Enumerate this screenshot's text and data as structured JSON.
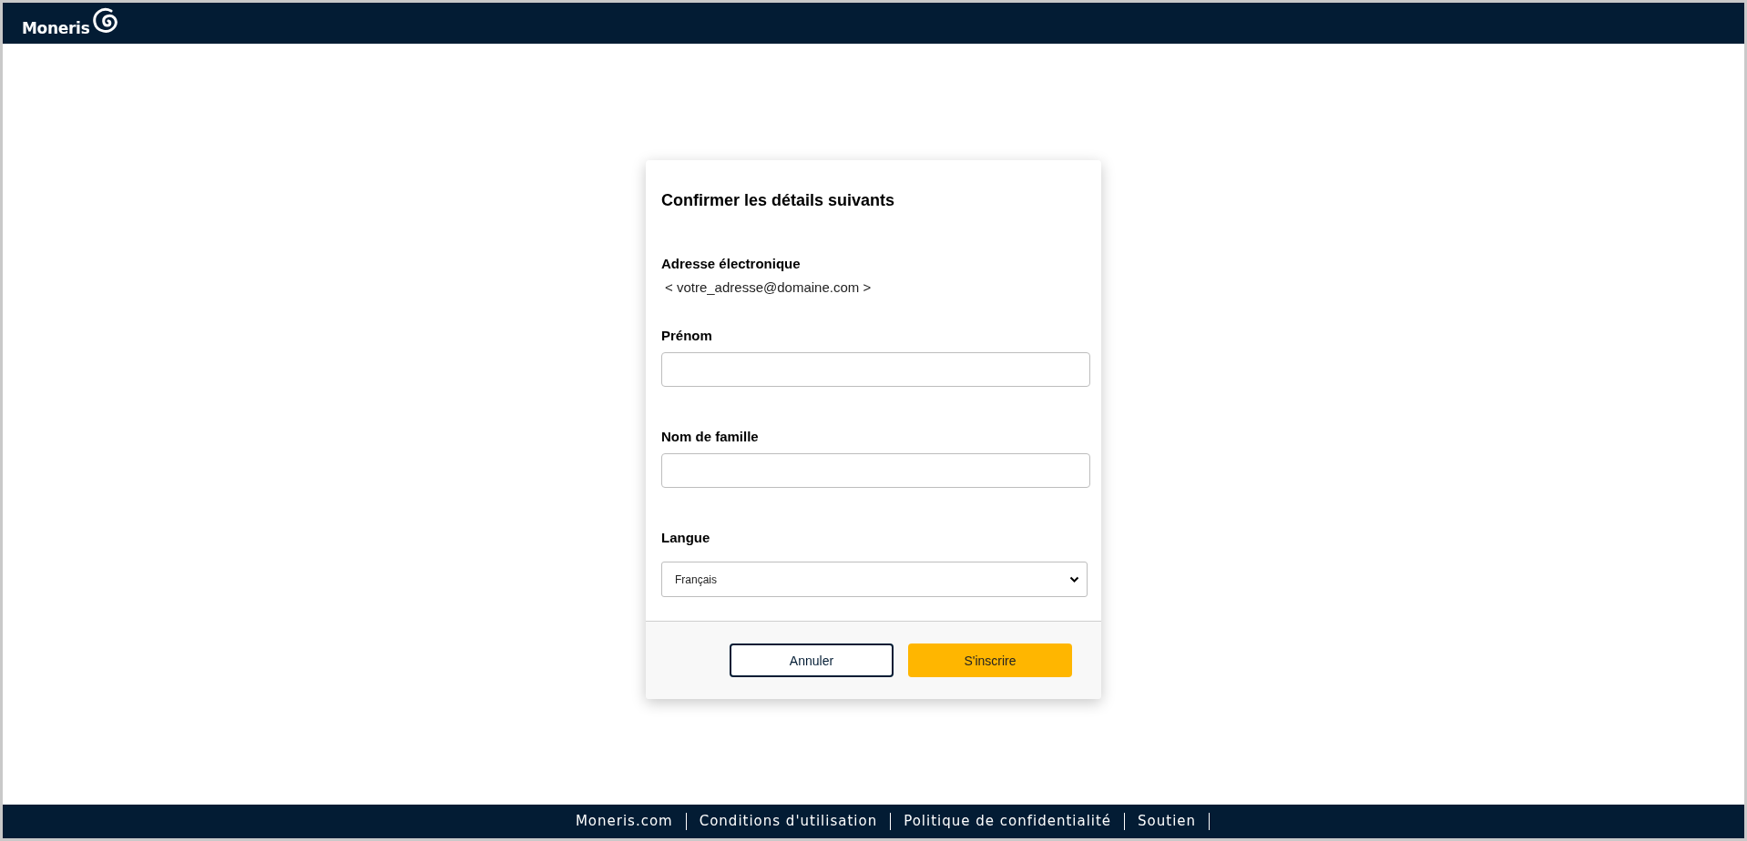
{
  "header": {
    "logo_text": "Moneris"
  },
  "dialog": {
    "title": "Confirmer les détails suivants",
    "fields": [
      {
        "kind": "static",
        "label": "Adresse électronique",
        "value": "< votre_adresse@domaine.com >"
      },
      {
        "kind": "text",
        "label": "Prénom"
      },
      {
        "kind": "text",
        "label": "Nom de famille"
      },
      {
        "kind": "select",
        "label": "Langue",
        "value": "Français"
      }
    ],
    "buttons": [
      {
        "kind": "secondary",
        "label": "Annuler"
      },
      {
        "kind": "primary",
        "label": "S'inscrire"
      }
    ]
  },
  "footer": {
    "links": [
      "Moneris.com",
      "Conditions d'utilisation",
      "Politique de confidentialité",
      "Soutien"
    ]
  }
}
